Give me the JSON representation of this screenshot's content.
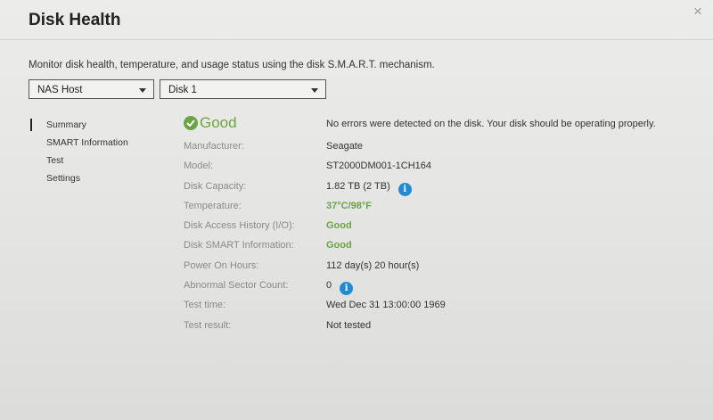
{
  "window": {
    "title": "Disk Health",
    "close_glyph": "×"
  },
  "description": "Monitor disk health, temperature, and usage status using the disk S.M.A.R.T. mechanism.",
  "selectors": {
    "host": "NAS Host",
    "disk": "Disk 1"
  },
  "sidebar": {
    "items": [
      {
        "label": "Summary",
        "active": true
      },
      {
        "label": "SMART Information",
        "active": false
      },
      {
        "label": "Test",
        "active": false
      },
      {
        "label": "Settings",
        "active": false
      }
    ]
  },
  "summary": {
    "status": "Good",
    "status_message": "No errors were detected on the disk. Your disk should be operating properly.",
    "rows": [
      {
        "label": "Manufacturer:",
        "value": "Seagate"
      },
      {
        "label": "Model:",
        "value": "ST2000DM001-1CH164"
      },
      {
        "label": "Disk Capacity:",
        "value": "1.82 TB (2 TB)",
        "info": true
      },
      {
        "label": "Temperature:",
        "value": "37°C/98°F"
      },
      {
        "label": "Disk Access History (I/O):",
        "value": "Good"
      },
      {
        "label": "Disk SMART Information:",
        "value": "Good"
      },
      {
        "label": "Power On Hours:",
        "value": "112 day(s) 20 hour(s)"
      },
      {
        "label": "Abnormal Sector Count:",
        "value": "0",
        "info": true
      },
      {
        "label": "Test time:",
        "value": "Wed Dec 31 13:00:00 1969"
      },
      {
        "label": "Test result:",
        "value": "Not tested"
      }
    ]
  },
  "colors": {
    "good": "#6aa544",
    "info": "#1f8ad6"
  }
}
